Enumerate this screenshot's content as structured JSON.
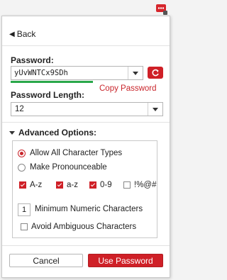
{
  "extension": {
    "icon": "password-generator-icon"
  },
  "nav": {
    "back_label": "Back"
  },
  "password": {
    "label": "Password:",
    "value": "yUvWNTCx9SDh",
    "strength": 0.62,
    "copy_label": "Copy Password"
  },
  "length": {
    "label": "Password Length:",
    "value": "12"
  },
  "advanced": {
    "label": "Advanced Options:",
    "radio_all": "Allow All Character Types",
    "radio_pronounceable": "Make Pronounceable",
    "upper": "A-z",
    "lower": "a-z",
    "digits": "0-9",
    "symbols": "!%@#",
    "min_numeric_value": "1",
    "min_numeric_label": "Minimum Numeric Characters",
    "avoid_ambiguous": "Avoid Ambiguous Characters"
  },
  "buttons": {
    "cancel": "Cancel",
    "use": "Use Password"
  },
  "colors": {
    "accent": "#cf2027",
    "strength": "#2aa84a"
  }
}
